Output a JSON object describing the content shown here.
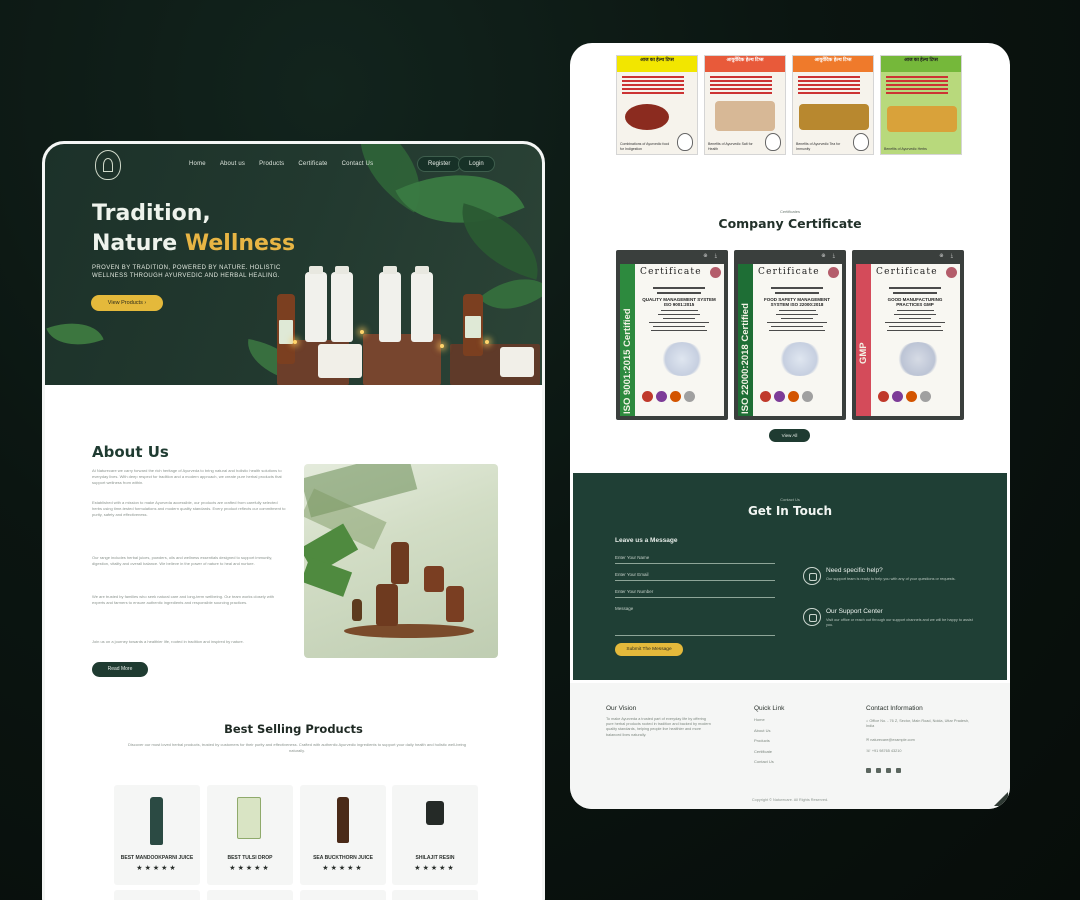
{
  "left_page": {
    "nav": {
      "links": [
        "Home",
        "About us",
        "Products",
        "Certificate",
        "Contact Us"
      ],
      "register_label": "Register",
      "login_label": "Login"
    },
    "hero": {
      "title_line1": "Tradition,",
      "title_line2_plain": "Nature ",
      "title_line2_accent": "Wellness",
      "subtitle": "PROVEN BY TRADITION, POWERED BY NATURE. HOLISTIC WELLNESS THROUGH AYURVEDIC AND HERBAL HEALING.",
      "cta_label": "View Products  ›"
    },
    "about": {
      "title": "About Us",
      "paragraphs": [
        "At Naturecare we carry forward the rich heritage of Ayurveda to bring natural and holistic health solutions to everyday lives. With deep respect for tradition and a modern approach, we create pure herbal products that support wellness from within.",
        "Established with a mission to make Ayurveda accessible, our products are crafted from carefully selected herbs using time-tested formulations and modern quality standards. Every product reflects our commitment to purity, safety and effectiveness.",
        "Our range includes herbal juices, powders, oils and wellness essentials designed to support immunity, digestion, vitality and overall balance. We believe in the power of nature to heal and nurture.",
        "We are trusted by families who seek natural care and long-term wellbeing. Our team works closely with experts and farmers to ensure authentic ingredients and responsible sourcing practices.",
        "Join us on a journey towards a healthier life, rooted in tradition and inspired by nature."
      ],
      "read_more_label": "Read More"
    },
    "best_selling": {
      "title": "Best Selling Products",
      "subtitle": "Discover our most loved herbal products, trusted by customers for their purity and effectiveness. Crafted with authentic Ayurvedic ingredients to support your daily health and holistic well-being naturally.",
      "products": [
        {
          "name": "BEST MANDOOKPARNI JUICE",
          "stars": "★★★★★"
        },
        {
          "name": "BEST TULSI DROP",
          "stars": "★★★★★"
        },
        {
          "name": "SEA BUCKTHORN JUICE",
          "stars": "★★★★★"
        },
        {
          "name": "SHILAJIT RESIN",
          "stars": "★★★★★"
        }
      ]
    }
  },
  "right_page": {
    "posters": [
      {
        "head": "आज का हेल्थ टिप्स",
        "caption": "Combinations of Ayurvedic food for Indigestion",
        "color": "#f2e600"
      },
      {
        "head": "आयुर्वेदिक हेल्थ टिप्स",
        "caption": "Benefits of Ayurvedic Salt for Health",
        "color": "#e85a3a"
      },
      {
        "head": "आयुर्वेदिक हेल्थ टिप्स",
        "caption": "Benefits of Ayurvedic Tea for Immunity",
        "color": "#ef7a2b"
      },
      {
        "head": "आज का हेल्थ टिप्स",
        "caption": "Benefits of Ayurvedic Herbs",
        "color": "#75b83a"
      }
    ],
    "certificates_small": "Certificates",
    "certificates_title": "Company Certificate",
    "certificates": [
      {
        "band": "ISO 9001:2015 Certified",
        "band_color": "#2d8a3e",
        "word": "Certificate",
        "standard": "QUALITY MANAGEMENT SYSTEM ISO 9001:2015"
      },
      {
        "band": "ISO 22000:2018 Certified",
        "band_color": "#1e6e35",
        "word": "Certificate",
        "standard": "FOOD SAFETY MANAGEMENT SYSTEM ISO 22000:2018"
      },
      {
        "band": "GMP",
        "band_color": "#d44b5a",
        "word": "Certificate",
        "standard": "GOOD MANUFACTURING PRACTICES GMP"
      }
    ],
    "view_all_label": "View All",
    "contact": {
      "small": "Contact Us",
      "title": "Get In Touch",
      "form_title": "Leave us a Message",
      "name_placeholder": "Enter Your Name",
      "email_placeholder": "Enter Your Email",
      "phone_placeholder": "Enter Your Number",
      "message_placeholder": "Message",
      "submit_label": "Submit The Message",
      "help_title": "Need specific help?",
      "help_text": "Our support team is ready to help you with any of your questions or requests.",
      "support_title": "Our Support Center",
      "support_text": "Visit our office or reach out through our support channels and we will be happy to assist you."
    },
    "footer": {
      "vision_title": "Our Vision",
      "vision_text": "To make Ayurveda a trusted part of everyday life by offering pure herbal products rooted in tradition and backed by modern quality standards, helping people live healthier and more balanced lives naturally.",
      "quick_title": "Quick Link",
      "quick_links": [
        "Home",
        "About Us",
        "Products",
        "Certificate",
        "Contact Us"
      ],
      "contact_title": "Contact Information",
      "address": "Office No. - 76 Z, Sector, Main Road, Noida, Uttar Pradesh, India",
      "email": "naturecare@example.com",
      "phone": "+91 98765 43210",
      "copyright": "Copyright © Naturecare. All Rights Reserved."
    }
  },
  "colors": {
    "accent": "#e4b93b",
    "brand_green": "#1f3b31",
    "contact_bg": "#1f3f35"
  }
}
